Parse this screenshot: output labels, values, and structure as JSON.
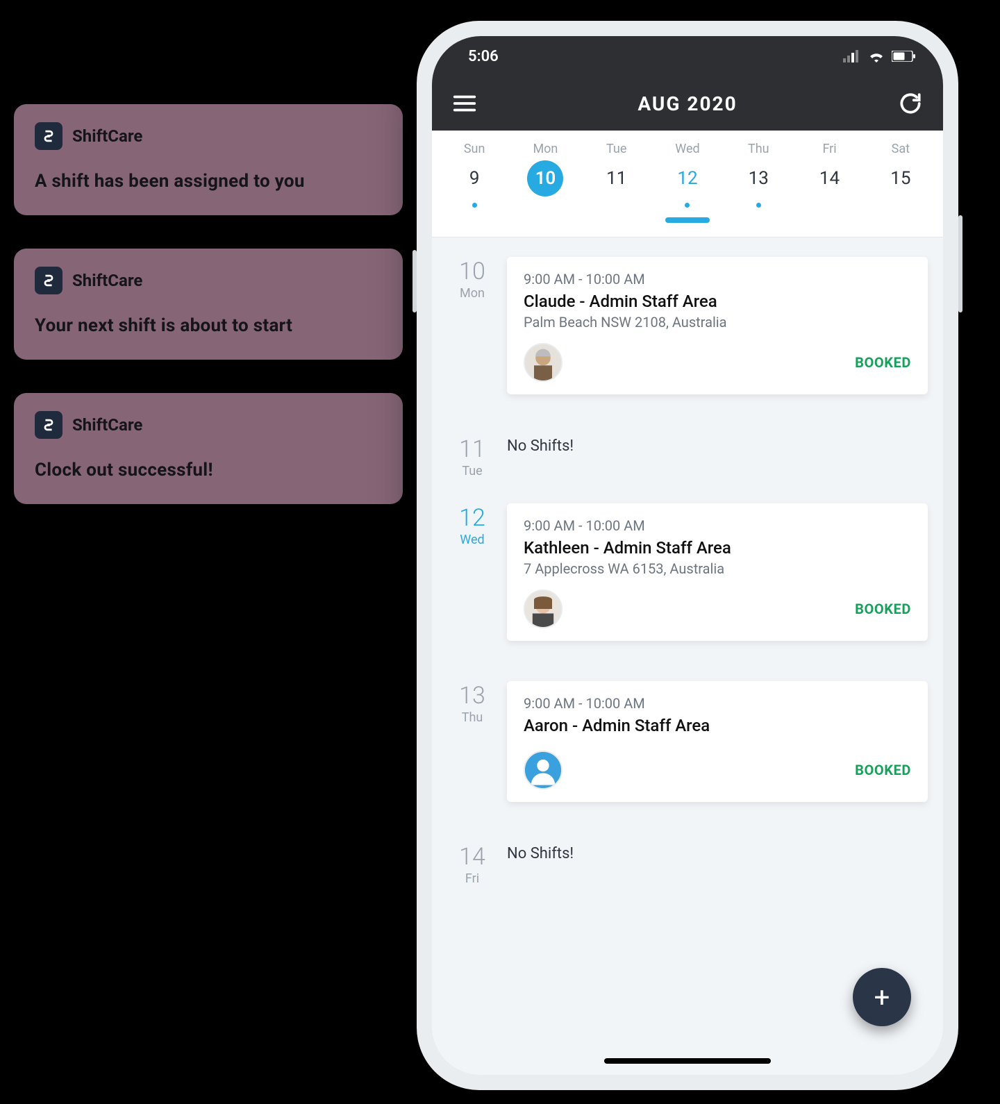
{
  "notifications": [
    {
      "app": "ShiftCare",
      "message": "A shift has been assigned to you"
    },
    {
      "app": "ShiftCare",
      "message": "Your next shift is about to start"
    },
    {
      "app": "ShiftCare",
      "message": "Clock out successful!"
    }
  ],
  "status": {
    "time": "5:06"
  },
  "header": {
    "title": "AUG 2020"
  },
  "week": {
    "days": [
      {
        "label": "Sun",
        "num": "9",
        "has_dot": true,
        "active": false,
        "accent": false
      },
      {
        "label": "Mon",
        "num": "10",
        "has_dot": false,
        "active": true,
        "accent": false
      },
      {
        "label": "Tue",
        "num": "11",
        "has_dot": false,
        "active": false,
        "accent": false
      },
      {
        "label": "Wed",
        "num": "12",
        "has_dot": true,
        "active": false,
        "accent": true
      },
      {
        "label": "Thu",
        "num": "13",
        "has_dot": true,
        "active": false,
        "accent": false
      },
      {
        "label": "Fri",
        "num": "14",
        "has_dot": false,
        "active": false,
        "accent": false
      },
      {
        "label": "Sat",
        "num": "15",
        "has_dot": false,
        "active": false,
        "accent": false
      }
    ]
  },
  "schedule": [
    {
      "day_num": "10",
      "day_name": "Mon",
      "accent": false,
      "shifts": [
        {
          "time": "9:00 AM - 10:00 AM",
          "title": "Claude  - Admin Staff Area",
          "address": "Palm Beach NSW 2108, Australia",
          "status": "BOOKED",
          "avatar": "person1"
        }
      ]
    },
    {
      "day_num": "11",
      "day_name": "Tue",
      "accent": false,
      "empty_text": "No Shifts!"
    },
    {
      "day_num": "12",
      "day_name": "Wed",
      "accent": true,
      "shifts": [
        {
          "time": "9:00 AM - 10:00 AM",
          "title": "Kathleen - Admin Staff Area",
          "address": "7 Applecross WA 6153, Australia",
          "status": "BOOKED",
          "avatar": "person2"
        }
      ]
    },
    {
      "day_num": "13",
      "day_name": "Thu",
      "accent": false,
      "shifts": [
        {
          "time": "9:00 AM - 10:00 AM",
          "title": "Aaron - Admin Staff Area",
          "address": "",
          "status": "BOOKED",
          "avatar": "placeholder"
        }
      ]
    },
    {
      "day_num": "14",
      "day_name": "Fri",
      "accent": false,
      "empty_text": "No Shifts!"
    }
  ],
  "fab": {
    "label": "+"
  }
}
